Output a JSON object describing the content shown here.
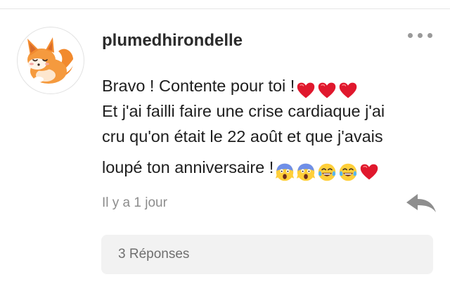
{
  "comment": {
    "avatar_icon": "sleeping-fox-icon",
    "username": "plumedhirondelle",
    "text_lines": [
      "Bravo ! Contente pour toi !",
      "Et j'ai failli faire une crise cardiaque j'ai",
      "cru qu'on était le 22 août et que j'avais",
      "loupé ton anniversaire !"
    ],
    "line1_emojis": [
      "red-heart",
      "red-heart",
      "red-heart"
    ],
    "line4_emojis": [
      "screaming-face",
      "screaming-face",
      "tears-of-joy",
      "tears-of-joy",
      "red-heart"
    ],
    "timestamp": "Il y a 1 jour",
    "more_icon": "more-dots-icon",
    "reply_icon": "reply-arrow-icon",
    "replies_label": "3 Réponses"
  },
  "colors": {
    "username": "#2b2b2b",
    "text": "#1e1e1e",
    "muted": "#8c8c8c",
    "reply_bg": "#f2f2f2",
    "heart": "#e0182d",
    "fox_orange": "#f28a2e"
  }
}
